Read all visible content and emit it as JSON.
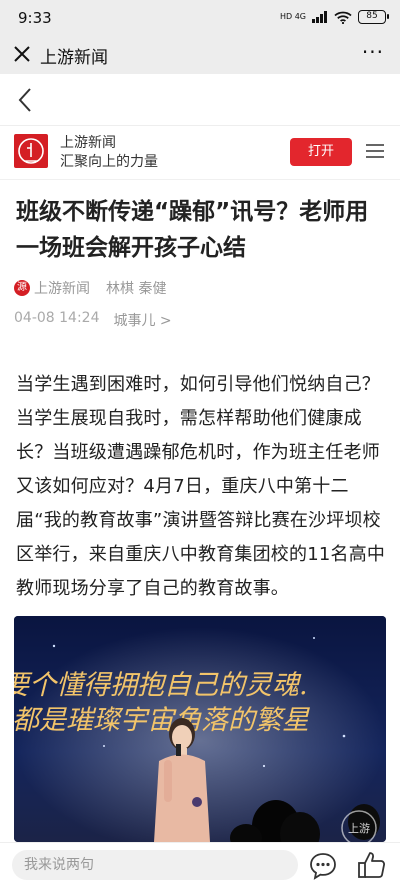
{
  "status_bar": {
    "time": "9:33",
    "network": "HD 4G",
    "battery": "85"
  },
  "wechat_bar": {
    "title": "上游新闻",
    "more": "···"
  },
  "app_header": {
    "name": "上游新闻",
    "slogan": "汇聚向上的力量",
    "open_label": "打开",
    "logo_char": "上游",
    "brand_color": "#d41e24"
  },
  "article": {
    "title": "班级不断传递“躁郁”讯号？老师用一场班会解开孩子心结",
    "source_icon": "源",
    "source": "上游新闻",
    "authors": "林棋 秦健",
    "date": "04-08 14:24",
    "column": "城事儿 >",
    "body": "当学生遇到困难时，如何引导他们悦纳自己？当学生展现自我时，需怎样帮助他们健康成长？当班级遭遇躁郁危机时，作为班主任老师又该如何应对？4月7日，重庆八中第十二届“我的教育故事”演讲暨答辩比赛在沙坪坝校区举行，来自重庆八中教育集团校的11名高中教师现场分享了自己的教育故事。",
    "photo": {
      "line1": "要个懂得拥抱自己的灵魂.",
      "line2": "都是璀璨宇宙角落的繁星",
      "watermark": "上游"
    }
  },
  "bottom_bar": {
    "comment_placeholder": "我来说两句"
  }
}
